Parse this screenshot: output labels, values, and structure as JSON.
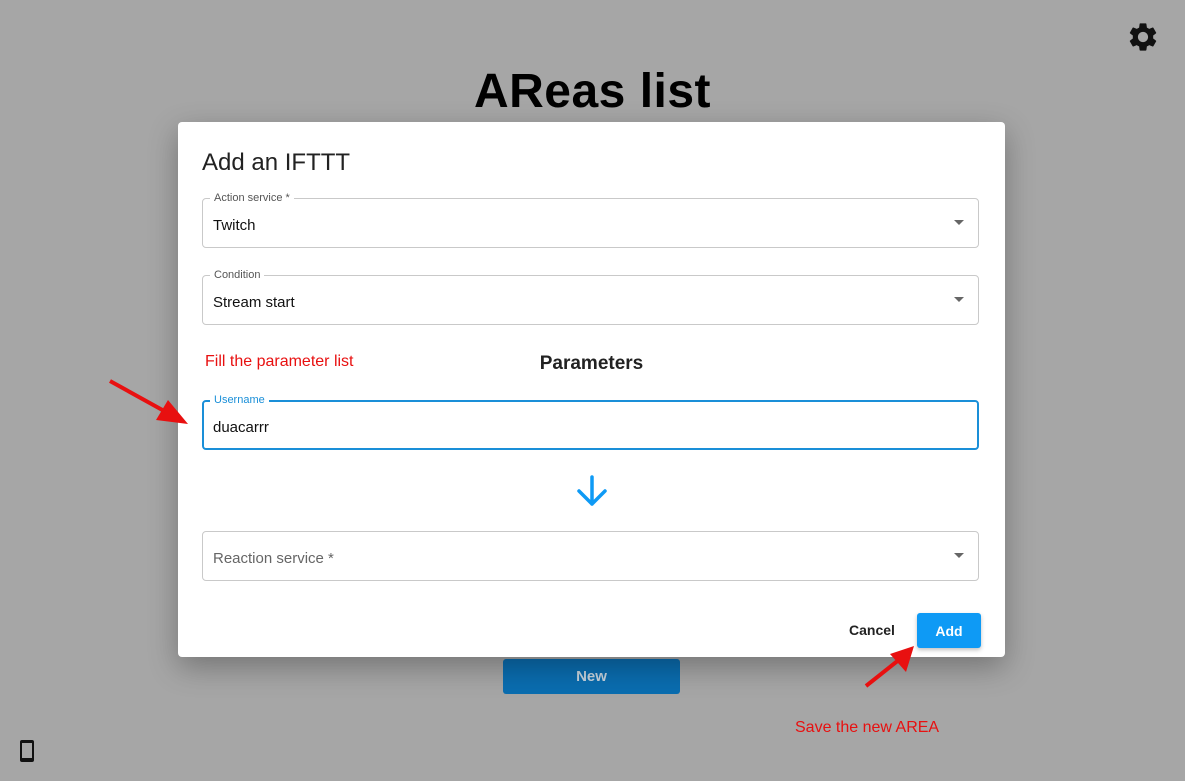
{
  "page": {
    "title": "AReas list"
  },
  "icons": {
    "settings": "gear-icon",
    "device": "phone-icon",
    "flow": "arrow-down-icon"
  },
  "new_button": {
    "label": "New"
  },
  "dialog": {
    "title": "Add an IFTTT",
    "action_service": {
      "label": "Action service *",
      "value": "Twitch"
    },
    "condition": {
      "label": "Condition",
      "value": "Stream start"
    },
    "parameters_heading": "Parameters",
    "username": {
      "label": "Username",
      "value": "duacarrr"
    },
    "reaction_service": {
      "placeholder": "Reaction service *"
    },
    "cancel_label": "Cancel",
    "add_label": "Add"
  },
  "annotations": {
    "fill_params": "Fill the parameter list",
    "save_area": "Save the new AREA"
  },
  "colors": {
    "overlay": "#a6a6a6",
    "accent": "#0e9af5",
    "annotation": "#e81010",
    "focus": "#1a8fd8"
  }
}
